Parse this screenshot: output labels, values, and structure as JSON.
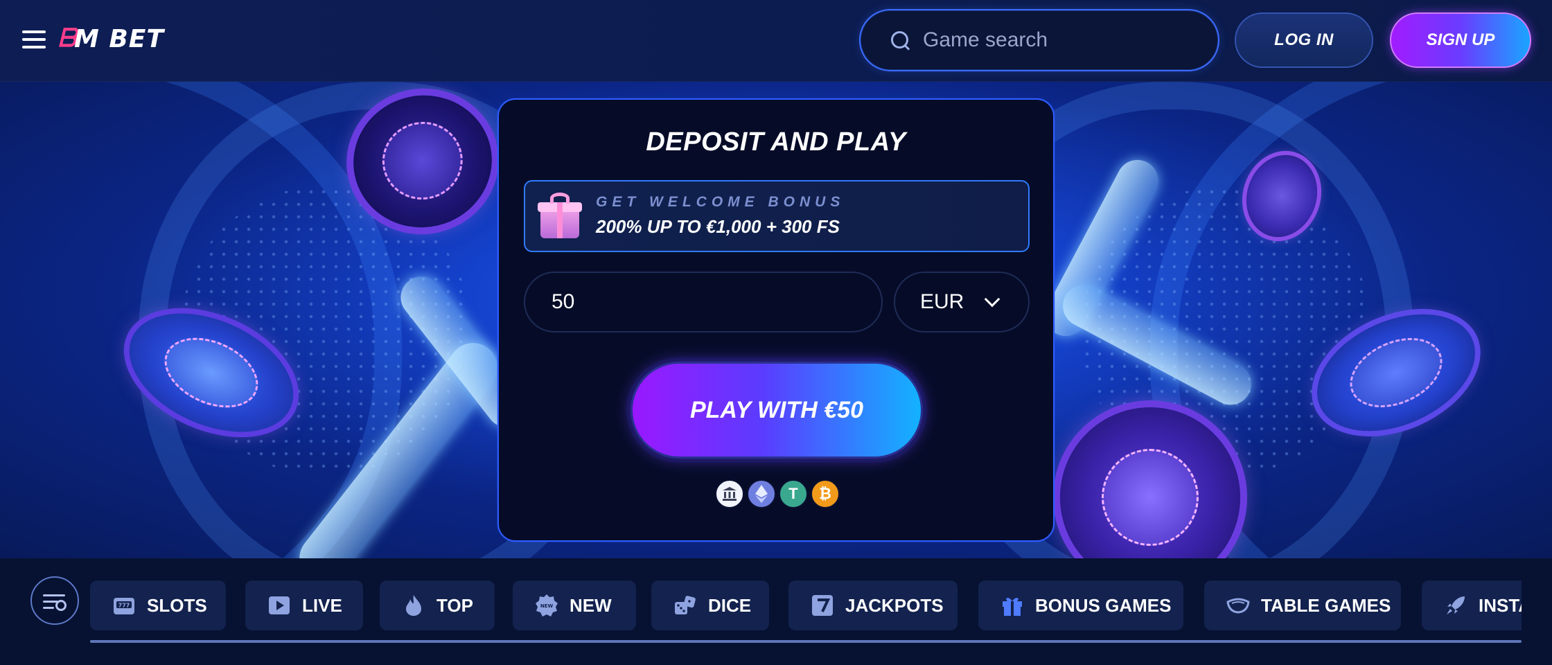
{
  "header": {
    "logo_mark": "ᗷ",
    "logo_text": "M BET",
    "search_placeholder": "Game search",
    "login_label": "LOG IN",
    "signup_label": "SIGN UP"
  },
  "deposit": {
    "title": "DEPOSIT AND PLAY",
    "bonus_kicker": "GET WELCOME BONUS",
    "bonus_text": "200% UP TO €1,000 + 300 FS",
    "amount_value": "50",
    "currency": "EUR",
    "play_label": "PLAY WITH €50",
    "payment_methods": [
      "bank-icon",
      "ethereum-icon",
      "tether-icon",
      "bitcoin-icon"
    ]
  },
  "categories": {
    "items": [
      {
        "label": "SLOTS",
        "icon": "slots-icon"
      },
      {
        "label": "LIVE",
        "icon": "play-icon"
      },
      {
        "label": "TOP",
        "icon": "flame-icon"
      },
      {
        "label": "NEW",
        "icon": "new-badge-icon"
      },
      {
        "label": "DICE",
        "icon": "dice-icon"
      },
      {
        "label": "JACKPOTS",
        "icon": "seven-icon"
      },
      {
        "label": "BONUS GAMES",
        "icon": "gift-icon"
      },
      {
        "label": "TABLE GAMES",
        "icon": "table-icon"
      },
      {
        "label": "INSTA",
        "icon": "rocket-icon"
      }
    ]
  },
  "colors": {
    "accent_blue": "#2e5cff",
    "accent_purple": "#9a18ff",
    "accent_cyan": "#13b2ff",
    "background": "#071232"
  }
}
